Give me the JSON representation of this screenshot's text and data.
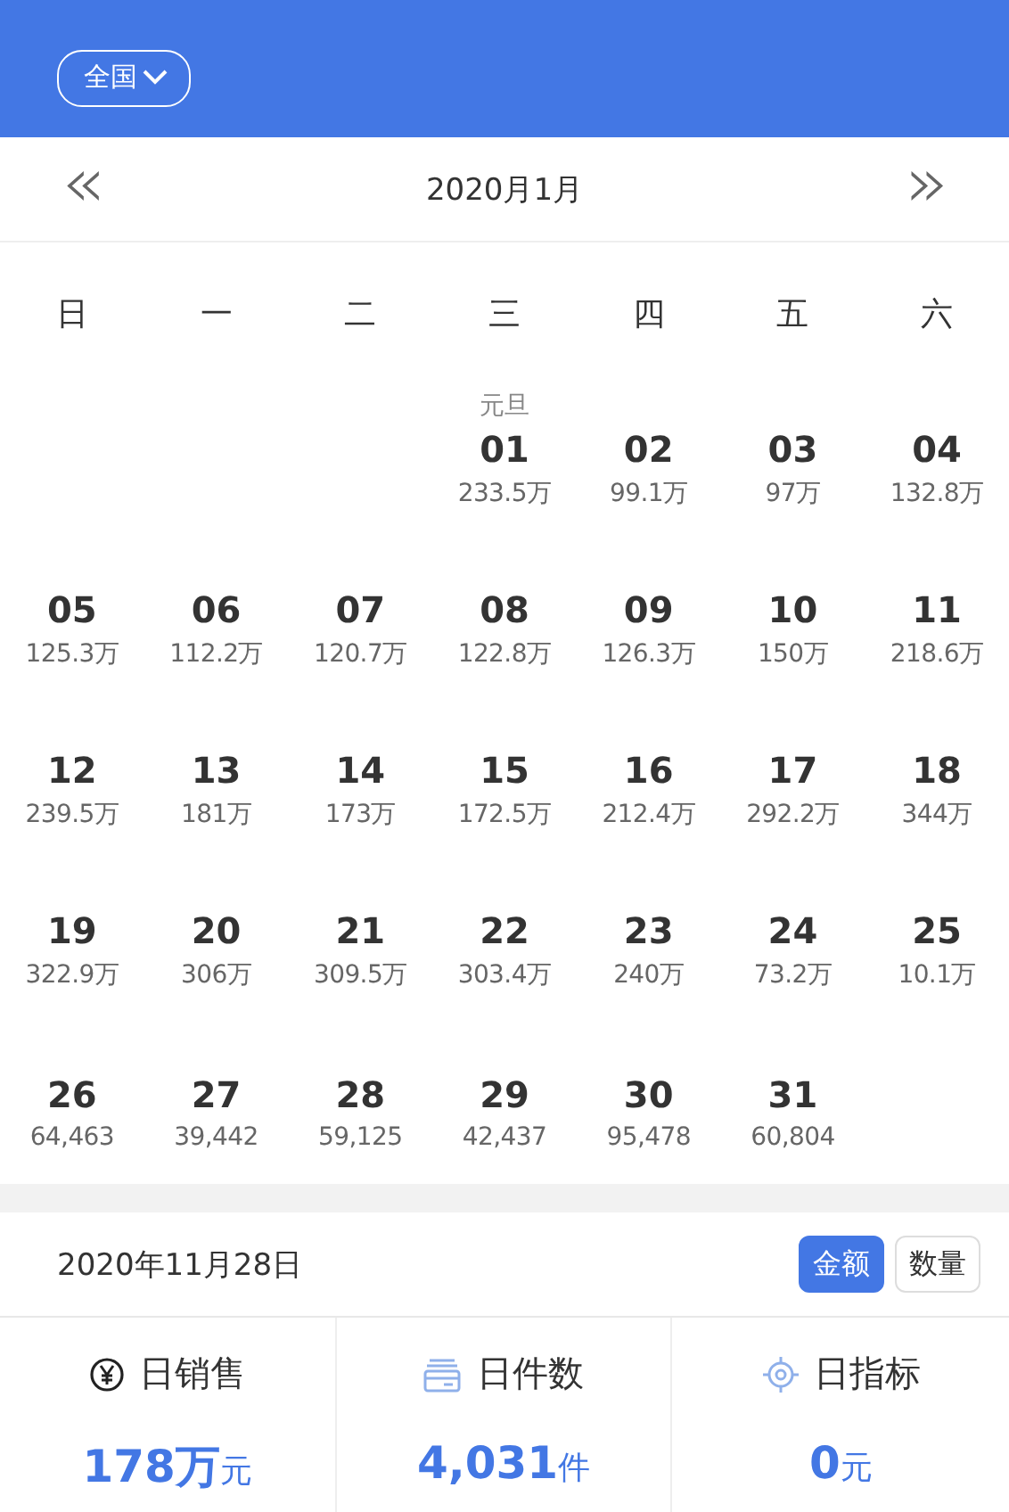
{
  "header": {
    "region_selector": {
      "label": "全国"
    }
  },
  "month_nav": {
    "prev": "«",
    "title": "2020月1月",
    "next": "»"
  },
  "weekdays": [
    "日",
    "一",
    "二",
    "三",
    "四",
    "五",
    "六"
  ],
  "weeks": [
    [
      {
        "kind": "blank"
      },
      {
        "kind": "blank"
      },
      {
        "kind": "blank"
      },
      {
        "kind": "day",
        "day": "01",
        "value": "233.5万",
        "holiday": "元旦"
      },
      {
        "kind": "day",
        "day": "02",
        "value": "99.1万"
      },
      {
        "kind": "day",
        "day": "03",
        "value": "97万"
      },
      {
        "kind": "day",
        "day": "04",
        "value": "132.8万"
      }
    ],
    [
      {
        "kind": "day",
        "day": "05",
        "value": "125.3万"
      },
      {
        "kind": "day",
        "day": "06",
        "value": "112.2万"
      },
      {
        "kind": "day",
        "day": "07",
        "value": "120.7万"
      },
      {
        "kind": "day",
        "day": "08",
        "value": "122.8万"
      },
      {
        "kind": "day",
        "day": "09",
        "value": "126.3万"
      },
      {
        "kind": "day",
        "day": "10",
        "value": "150万"
      },
      {
        "kind": "day",
        "day": "11",
        "value": "218.6万"
      }
    ],
    [
      {
        "kind": "day",
        "day": "12",
        "value": "239.5万"
      },
      {
        "kind": "day",
        "day": "13",
        "value": "181万"
      },
      {
        "kind": "day",
        "day": "14",
        "value": "173万"
      },
      {
        "kind": "day",
        "day": "15",
        "value": "172.5万"
      },
      {
        "kind": "day",
        "day": "16",
        "value": "212.4万"
      },
      {
        "kind": "day",
        "day": "17",
        "value": "292.2万"
      },
      {
        "kind": "day",
        "day": "18",
        "value": "344万"
      }
    ],
    [
      {
        "kind": "day",
        "day": "19",
        "value": "322.9万"
      },
      {
        "kind": "day",
        "day": "20",
        "value": "306万"
      },
      {
        "kind": "day",
        "day": "21",
        "value": "309.5万"
      },
      {
        "kind": "day",
        "day": "22",
        "value": "303.4万"
      },
      {
        "kind": "day",
        "day": "23",
        "value": "240万"
      },
      {
        "kind": "day",
        "day": "24",
        "value": "73.2万"
      },
      {
        "kind": "day",
        "day": "25",
        "value": "10.1万"
      }
    ],
    [
      {
        "kind": "day",
        "day": "26",
        "value": "64,463"
      },
      {
        "kind": "day",
        "day": "27",
        "value": "39,442"
      },
      {
        "kind": "day",
        "day": "28",
        "value": "59,125"
      },
      {
        "kind": "day",
        "day": "29",
        "value": "42,437"
      },
      {
        "kind": "day",
        "day": "30",
        "value": "95,478"
      },
      {
        "kind": "day",
        "day": "31",
        "value": "60,804"
      },
      {
        "kind": "blank"
      }
    ]
  ],
  "summary": {
    "date": "2020年11月28日",
    "toggles": [
      {
        "label": "金额",
        "selected": true
      },
      {
        "label": "数量",
        "selected": false
      }
    ]
  },
  "stats": [
    {
      "kind": "yen",
      "label": "日销售",
      "value": "178万",
      "unit": "元"
    },
    {
      "kind": "card",
      "label": "日件数",
      "value": "4,031",
      "unit": "件"
    },
    {
      "kind": "target",
      "label": "日指标",
      "value": "0",
      "unit": "元"
    }
  ]
}
